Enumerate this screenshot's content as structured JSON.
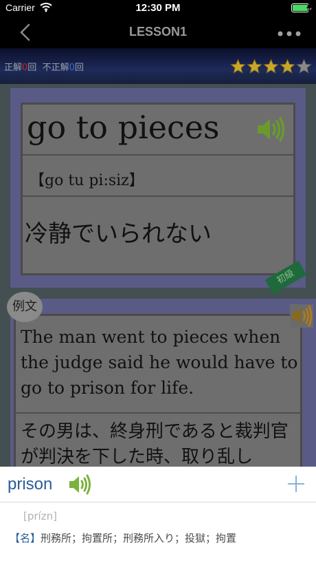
{
  "status_bar": {
    "carrier": "Carrier",
    "time": "12:30 PM"
  },
  "nav": {
    "title": "LESSON1",
    "back_icon": "chevron-left-icon",
    "more_icon": "more-dots-icon"
  },
  "stats": {
    "correct_label": "正解",
    "correct_count": "0",
    "correct_suffix": "回",
    "incorrect_label": "不正解",
    "incorrect_count": "0",
    "incorrect_suffix": "回",
    "rating": 4,
    "rating_max": 5
  },
  "word_card": {
    "word": "go to pieces",
    "pronunciation": "【go tu pi:siz】",
    "meaning": "冷静でいられない",
    "level": "初級"
  },
  "example_card": {
    "label": "例文",
    "sentence": "The man went to pieces when the judge said he would have to go to prison for life.",
    "translation": "その男は、終身刑であると裁判官が判決を下した時、取り乱し"
  },
  "lookup": {
    "term": "prison",
    "phonetic": "[prízn]",
    "pos": "【名】",
    "definition": "刑務所；拘置所；刑務所入り；投獄；拘置"
  },
  "colors": {
    "speaker_green": "#7ab23c",
    "star_gold": "#c8a82a",
    "accent_blue": "#2a5c9a",
    "correct_red": "#d02020",
    "incorrect_blue": "#3a6ad0"
  }
}
